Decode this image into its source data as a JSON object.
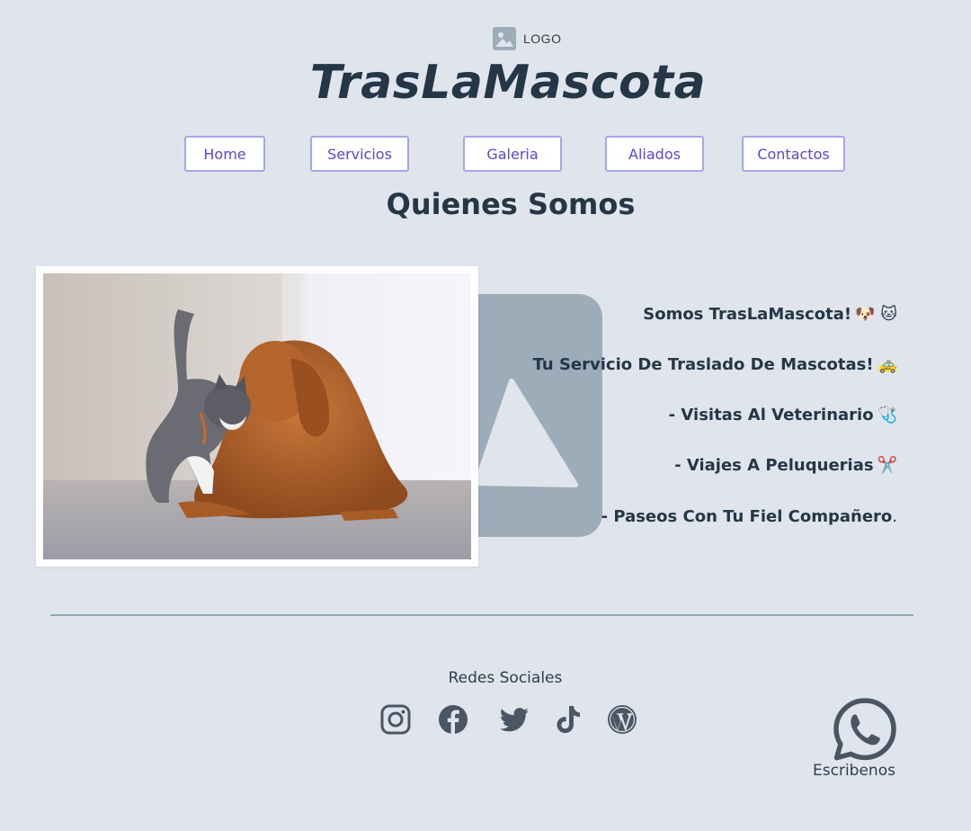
{
  "header": {
    "logo_label": "LOGO",
    "logo_icon": "image-icon",
    "site_title": "TrasLaMascota"
  },
  "nav": {
    "items": [
      {
        "label": "Home"
      },
      {
        "label": "Servicios"
      },
      {
        "label": "Galeria"
      },
      {
        "label": "Aliados"
      },
      {
        "label": "Contactos"
      }
    ]
  },
  "about": {
    "section_title": "Quienes Somos",
    "photo_alt": "Gato y perro",
    "lines": [
      {
        "text": "Somos TrasLaMascota!",
        "emoji": "🐶 🐱"
      },
      {
        "text": "Tu Servicio De Traslado De Mascotas!",
        "emoji": "🚕"
      },
      {
        "text": "- Visitas Al Veterinario",
        "emoji": "🩺"
      },
      {
        "text": "- Viajes A Peluquerias",
        "emoji": "✂️"
      },
      {
        "text": "- Paseos Con Tu Fiel Compañero",
        "emoji": "."
      }
    ]
  },
  "footer": {
    "social_title": "Redes Sociales",
    "social_icons": [
      "instagram-icon",
      "facebook-icon",
      "twitter-icon",
      "tiktok-icon",
      "wordpress-icon"
    ],
    "whatsapp_label": "Escribenos",
    "whatsapp_icon": "whatsapp-icon"
  },
  "colors": {
    "background": "#dfe4ed",
    "text": "#253746",
    "nav_border": "#a9a4ec",
    "nav_text": "#5848d8",
    "icon": "#4a5663",
    "placeholder": "#9dacb9"
  }
}
